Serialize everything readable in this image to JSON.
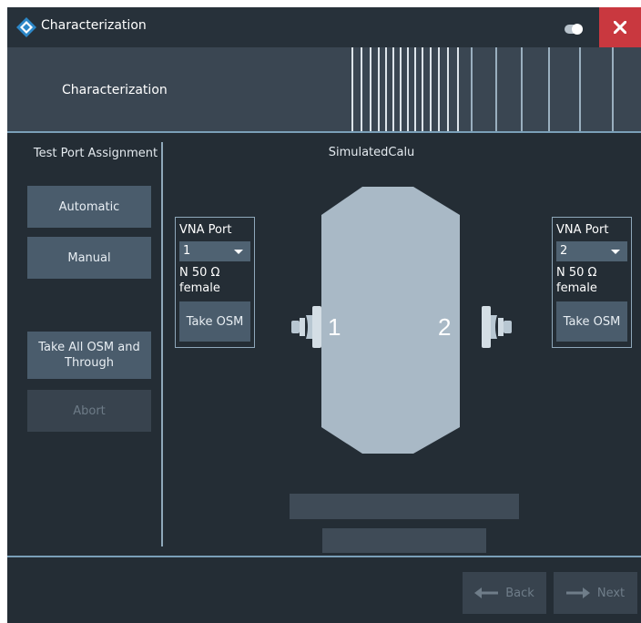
{
  "window": {
    "title": "Characterization",
    "close_icon": "×"
  },
  "banner": {
    "title": "Characterization"
  },
  "assignment": {
    "title": "Test Port Assignment",
    "automatic": "Automatic",
    "manual": "Manual",
    "take_all": "Take All OSM and Through",
    "abort": "Abort"
  },
  "device": {
    "name": "SimulatedCalu",
    "port1_number": "1",
    "port2_number": "2"
  },
  "ports": [
    {
      "label": "VNA Port",
      "selected": "1",
      "connector": "N 50 Ω female",
      "take": "Take OSM"
    },
    {
      "label": "VNA Port",
      "selected": "2",
      "connector": "N 50 Ω female",
      "take": "Take OSM"
    }
  ],
  "footer": {
    "back": "Back",
    "next": "Next"
  },
  "colors": {
    "background": "#242d35",
    "banner": "#3a4652",
    "accent_line": "#7a9fb8",
    "button": "#4a5c6c",
    "close": "#c9383f",
    "device_body": "#a9b9c6"
  }
}
